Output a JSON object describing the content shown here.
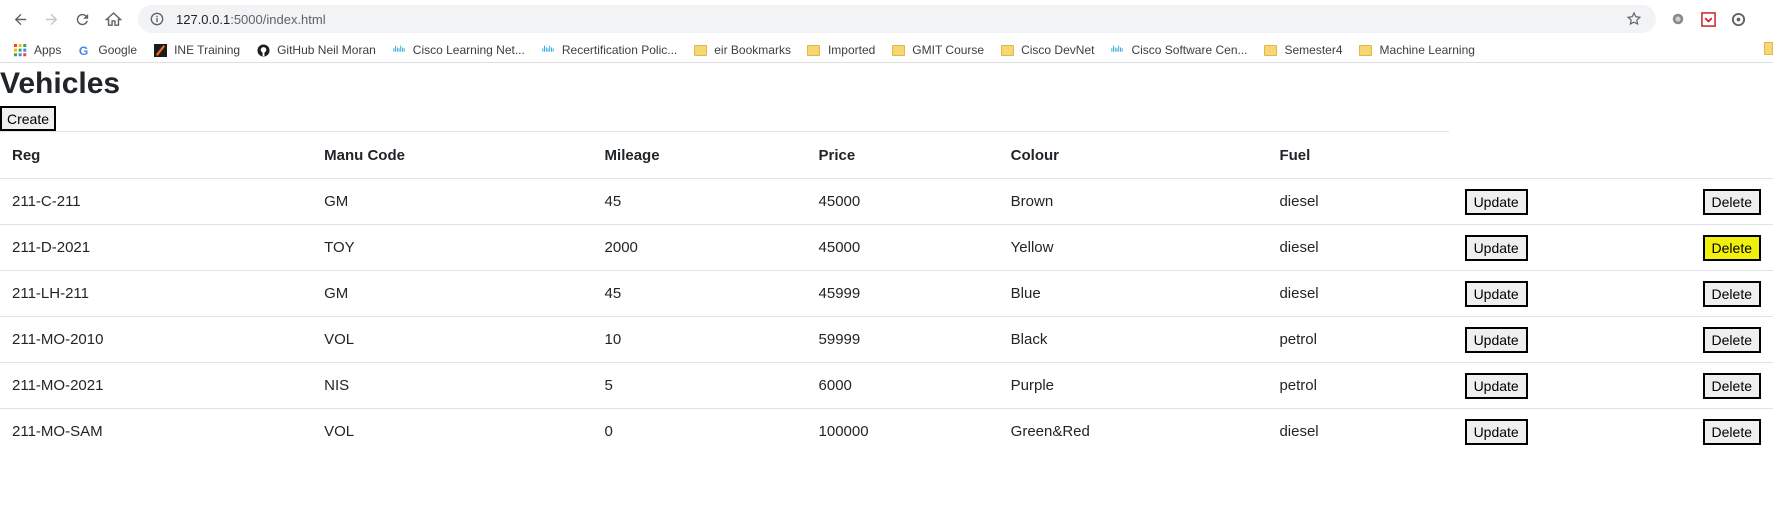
{
  "browser": {
    "url_host": "127.0.0.1",
    "url_rest": ":5000/index.html"
  },
  "bookmarks": [
    {
      "label": "Apps",
      "icon": "apps-grid-icon"
    },
    {
      "label": "Google",
      "icon": "google-icon"
    },
    {
      "label": "INE Training",
      "icon": "ine-icon"
    },
    {
      "label": "GitHub Neil Moran",
      "icon": "github-icon"
    },
    {
      "label": "Cisco Learning Net...",
      "icon": "cisco-icon"
    },
    {
      "label": "Recertification Polic...",
      "icon": "cisco-icon"
    },
    {
      "label": "eir Bookmarks",
      "icon": "folder-icon"
    },
    {
      "label": "Imported",
      "icon": "folder-icon"
    },
    {
      "label": "GMIT Course",
      "icon": "folder-icon"
    },
    {
      "label": "Cisco DevNet",
      "icon": "folder-icon"
    },
    {
      "label": "Cisco Software Cen...",
      "icon": "cisco-icon"
    },
    {
      "label": "Semester4",
      "icon": "folder-icon"
    },
    {
      "label": "Machine Learning",
      "icon": "folder-icon"
    }
  ],
  "page": {
    "title": "Vehicles",
    "create_label": "Create"
  },
  "table": {
    "headers": [
      "Reg",
      "Manu Code",
      "Mileage",
      "Price",
      "Colour",
      "Fuel"
    ],
    "update_label": "Update",
    "delete_label": "Delete",
    "rows": [
      {
        "reg": "211-C-211",
        "manu": "GM",
        "mileage": "45",
        "price": "45000",
        "colour": "Brown",
        "fuel": "diesel"
      },
      {
        "reg": "211-D-2021",
        "manu": "TOY",
        "mileage": "2000",
        "price": "45000",
        "colour": "Yellow",
        "fuel": "diesel",
        "delete_highlight": true
      },
      {
        "reg": "211-LH-211",
        "manu": "GM",
        "mileage": "45",
        "price": "45999",
        "colour": "Blue",
        "fuel": "diesel"
      },
      {
        "reg": "211-MO-2010",
        "manu": "VOL",
        "mileage": "10",
        "price": "59999",
        "colour": "Black",
        "fuel": "petrol"
      },
      {
        "reg": "211-MO-2021",
        "manu": "NIS",
        "mileage": "5",
        "price": "6000",
        "colour": "Purple",
        "fuel": "petrol"
      },
      {
        "reg": "211-MO-SAM",
        "manu": "VOL",
        "mileage": "0",
        "price": "100000",
        "colour": "Green&Red",
        "fuel": "diesel"
      }
    ]
  },
  "colors": {
    "highlight": "#f0f00f",
    "border": "#dee2e6"
  }
}
